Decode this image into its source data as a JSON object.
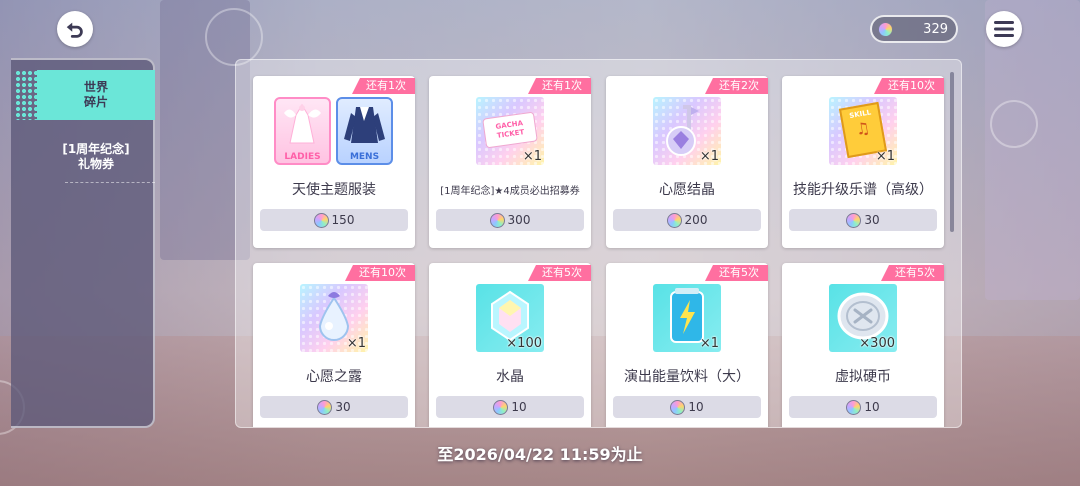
{
  "header": {
    "currency_amount": "329",
    "back_icon": "undo-arrow-icon",
    "menu_icon": "hamburger-icon"
  },
  "sidebar": {
    "items": [
      {
        "label": "世界\n碎片",
        "active": true
      },
      {
        "label": "[1周年纪念]\n礼物券",
        "active": false
      }
    ]
  },
  "shop": {
    "items": [
      {
        "name": "天使主题服装",
        "badge": "还有1次",
        "price": "150",
        "qty": "",
        "icon": "costume-ladies-mens-icon"
      },
      {
        "name": "[1周年纪念]★4成员必出招募券",
        "badge": "还有1次",
        "price": "300",
        "qty": "×1",
        "icon": "gacha-ticket-icon"
      },
      {
        "name": "心愿结晶",
        "badge": "还有2次",
        "price": "200",
        "qty": "×1",
        "icon": "wish-crystal-icon"
      },
      {
        "name": "技能升级乐谱（高级）",
        "badge": "还有10次",
        "price": "30",
        "qty": "×1",
        "icon": "skill-score-icon"
      },
      {
        "name": "心愿之露",
        "badge": "还有10次",
        "price": "30",
        "qty": "×1",
        "icon": "wish-dew-icon"
      },
      {
        "name": "水晶",
        "badge": "还有5次",
        "price": "10",
        "qty": "×100",
        "icon": "crystal-icon"
      },
      {
        "name": "演出能量饮料（大）",
        "badge": "还有5次",
        "price": "10",
        "qty": "×1",
        "icon": "energy-drink-icon"
      },
      {
        "name": "虚拟硬币",
        "badge": "还有5次",
        "price": "10",
        "qty": "×300",
        "icon": "virtual-coin-icon"
      }
    ],
    "ladies_label": "LADIES",
    "mens_label": "MENS",
    "ticket_label": "GACHA TICKET",
    "skill_label": "SKILL"
  },
  "footer": {
    "deadline": "至2026/04/22 11:59为止"
  }
}
